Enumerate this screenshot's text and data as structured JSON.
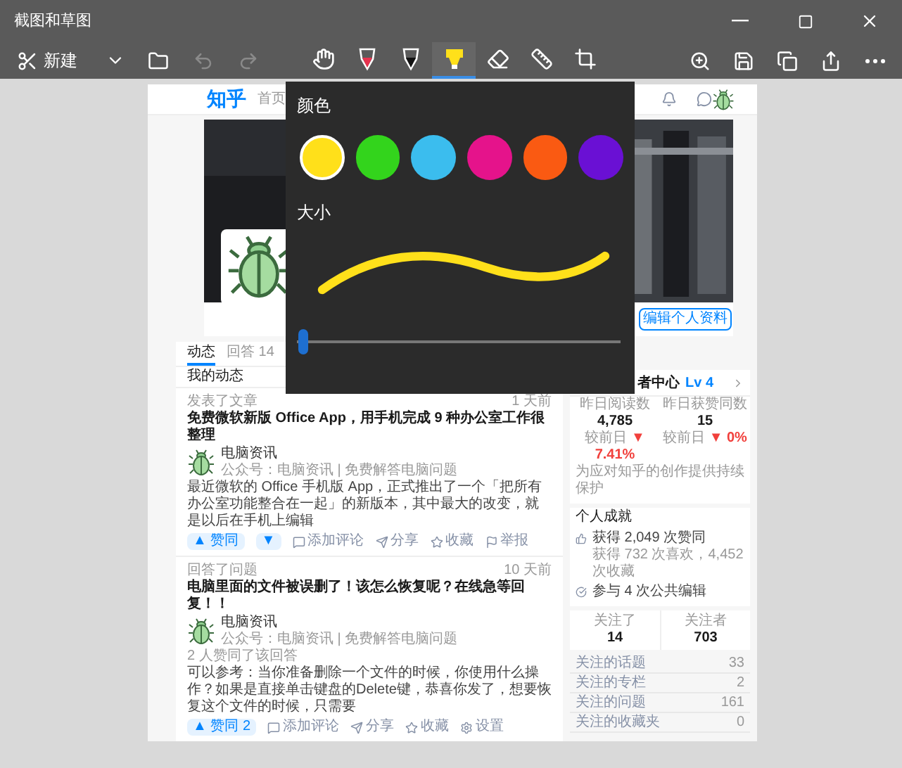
{
  "window": {
    "title": "截图和草图"
  },
  "toolbar": {
    "new_label": "新建",
    "history": [
      {
        "kind": "undo",
        "disabled": true
      },
      {
        "kind": "redo",
        "disabled": true
      }
    ],
    "tools": [
      {
        "kind": "touch",
        "selected": false
      },
      {
        "kind": "pen",
        "selected": false
      },
      {
        "kind": "pencil",
        "selected": false
      },
      {
        "kind": "highlighter",
        "selected": true
      },
      {
        "kind": "eraser",
        "selected": false
      },
      {
        "kind": "ruler",
        "selected": false
      },
      {
        "kind": "crop",
        "selected": false
      }
    ]
  },
  "flyout": {
    "color_label": "颜色",
    "colors": [
      {
        "color": "#ffe01a",
        "selected": true
      },
      {
        "color": "#33d41c",
        "selected": false
      },
      {
        "color": "#3bbdee",
        "selected": false
      },
      {
        "color": "#e5138b",
        "selected": false
      },
      {
        "color": "#fa5a12",
        "selected": false
      },
      {
        "color": "#6a10d4",
        "selected": false
      }
    ],
    "size_label": "大小",
    "size": {
      "level": 0.01
    }
  },
  "page": {
    "logo": "知乎",
    "nav": [
      "首页"
    ],
    "edit_profile": "编辑个人资料",
    "tabs": [
      {
        "label": "动态",
        "selected": true
      },
      {
        "label": "回答 14",
        "selected": false
      }
    ],
    "feed_title": "我的动态",
    "feed": [
      {
        "action": "发表了文章",
        "time": "1 天前",
        "title": "免费微软新版 Office App，用手机完成 9 种办公室工作很整理",
        "author": "电脑资讯",
        "author_info": "公众号：电脑资讯 | 免费解答电脑问题",
        "body": "最近微软的 Office 手机版 App，正式推出了一个「把所有办公室功能整合在一起」的新版本，其中最大的改变，就是以后在手机上编辑",
        "vote": "▲ 赞同",
        "down": "▼",
        "actions": [
          {
            "kind": "comment",
            "label": "添加评论"
          },
          {
            "kind": "share",
            "label": "分享"
          },
          {
            "kind": "favorite",
            "label": "收藏"
          },
          {
            "kind": "report",
            "label": "举报"
          }
        ]
      },
      {
        "action": "回答了问题",
        "time": "10 天前",
        "title": "电脑里面的文件被误删了！该怎么恢复呢？在线急等回复！！",
        "author": "电脑资讯",
        "author_info": "公众号：电脑资讯 | 免费解答电脑问题",
        "votes_note": "2 人赞同了该回答",
        "body": "可以参考：当你准备删除一个文件的时候，你使用什么操作？如果是直接单击键盘的Delete键，恭喜你发了，想要恢复这个文件的时候，只需要",
        "vote": "▲ 赞同 2",
        "actions": [
          {
            "kind": "comment",
            "label": "添加评论"
          },
          {
            "kind": "share",
            "label": "分享"
          },
          {
            "kind": "favorite",
            "label": "收藏"
          },
          {
            "kind": "settings",
            "label": "设置"
          }
        ]
      }
    ],
    "creator": {
      "title": "者中心",
      "level": "Lv 4"
    },
    "stats": [
      {
        "label": "昨日阅读数",
        "value": "4,785",
        "change_label": "较前日",
        "change": "▼ 7.41%"
      },
      {
        "label": "昨日获赞同数",
        "value": "15",
        "change_label": "较前日",
        "change": "▼ 0%"
      }
    ],
    "notice": "为应对知乎的创作提供持续保护",
    "achievements": {
      "title": "个人成就",
      "items": [
        {
          "kind": "likes",
          "text": "获得 2,049 次赞同",
          "detail": "获得 732 次喜欢，4,452 次收藏"
        },
        {
          "kind": "edits",
          "text": "参与 4 次公共编辑"
        }
      ]
    },
    "follows": [
      {
        "label": "关注了",
        "value": "14"
      },
      {
        "label": "关注者",
        "value": "703"
      }
    ],
    "lists": [
      {
        "label": "关注的话题",
        "count": "33"
      },
      {
        "label": "关注的专栏",
        "count": "2"
      },
      {
        "label": "关注的问题",
        "count": "161"
      },
      {
        "label": "关注的收藏夹",
        "count": "0"
      }
    ]
  }
}
